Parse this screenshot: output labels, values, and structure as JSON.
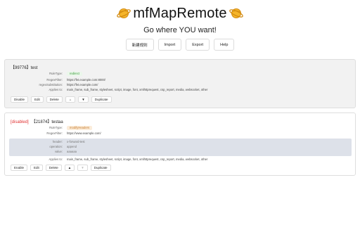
{
  "app": {
    "title": "mfMapRemote",
    "subtitle": "Go where YOU want!"
  },
  "toolbar": {
    "new_rule": "新建规则",
    "import": "Import",
    "export": "Export",
    "help": "Help"
  },
  "labels": {
    "rule_type": "RuleType:",
    "regex_filter": "RegexFilter:",
    "regex_substitution": "regexSubstitution:",
    "applies_to": "Applies to:",
    "header": "header:",
    "operation": "operation:",
    "value": "value:"
  },
  "rules": [
    {
      "heading": "【99776】test",
      "rule_type": "redirect",
      "regex_filter": "https://fet.example.com:8000/",
      "regex_substitution": "https://fet.example.com/",
      "applies_to": "main_frame,  sub_frame,  stylesheet,  script,  image,  font,  xmlhttprequest,  csp_report,  media,  websocket,  other",
      "buttons": {
        "toggle": "Disable",
        "edit": "Edit",
        "delete": "Delete",
        "up": "▲",
        "down": "▼",
        "duplicate": "Duplicate"
      }
    },
    {
      "disabled_label": "[disabled]",
      "heading": "【21874】testaa",
      "rule_type": "modifyHeaders",
      "regex_filter": "https://www.example.com/",
      "header": {
        "name": "x-forward-test",
        "operation": "append",
        "value": "aaaaaa"
      },
      "applies_to": "main_frame,  sub_frame,  stylesheet,  script,  image,  font,  xmlhttprequest,  csp_report,  media,  websocket,  other",
      "buttons": {
        "toggle": "Enable",
        "edit": "Edit",
        "delete": "Delete",
        "up": "▲",
        "down": "▼",
        "duplicate": "Duplicate"
      }
    }
  ],
  "colors": {
    "accent_orange": "#f5a623",
    "disabled_red": "#e03030",
    "redirect_green": "#3a9a3a",
    "modify_orange": "#c77a2a"
  },
  "icons": [
    "planet-logo-icon-left",
    "planet-logo-icon-right"
  ]
}
